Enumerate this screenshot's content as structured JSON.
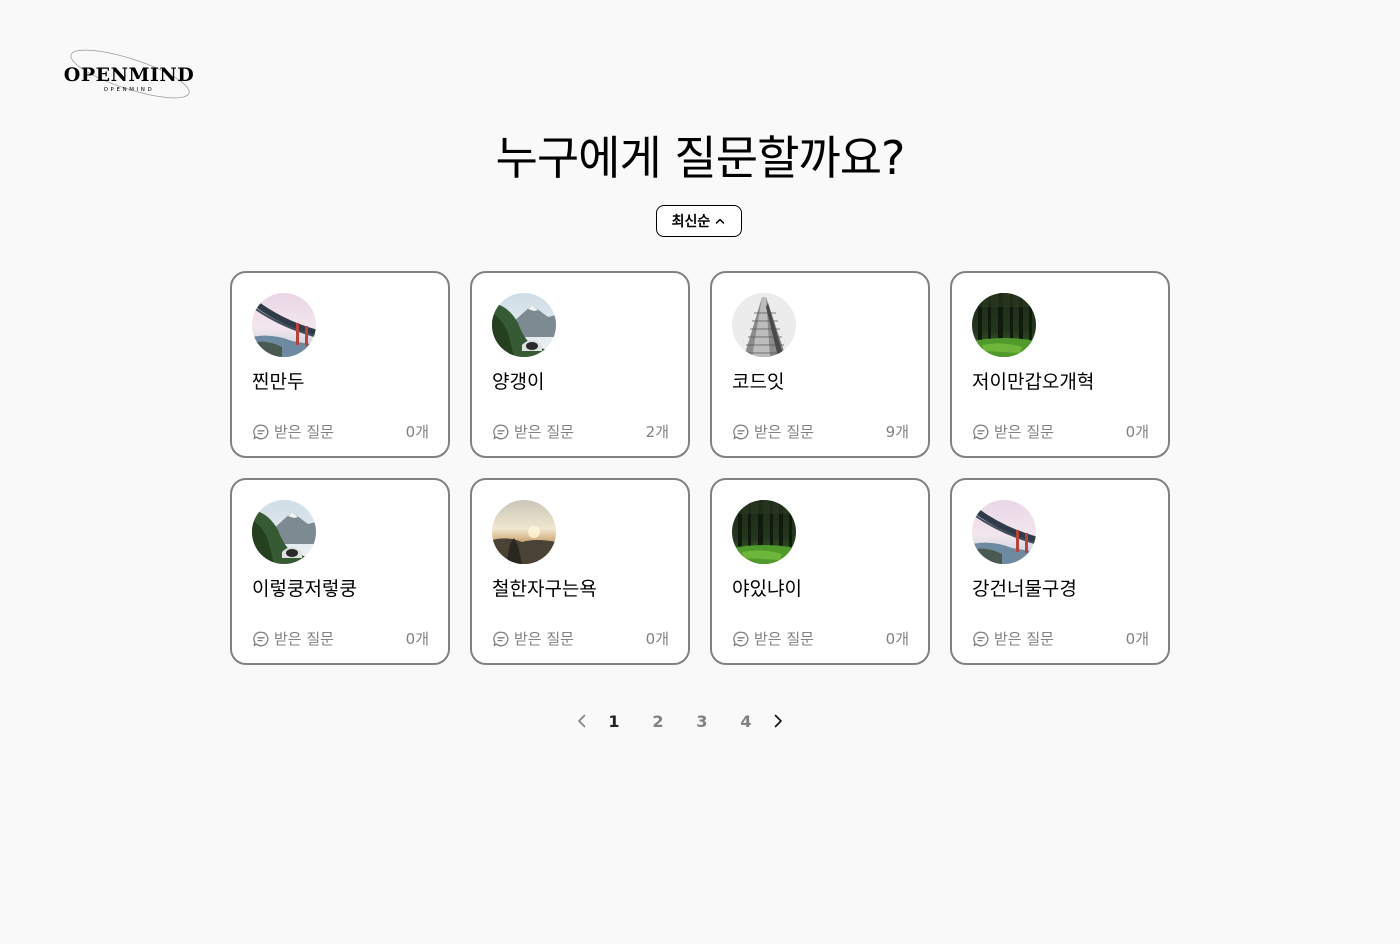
{
  "logo": {
    "text": "OPENMIND",
    "subtext": "OPENMIND"
  },
  "title": "누구에게 질문할까요?",
  "sort": {
    "label": "최신순",
    "icon": "chevron-up-icon"
  },
  "cards": [
    {
      "name": "찐만두",
      "stat_label": "받은 질문",
      "count": "0개",
      "avatar": "bridge"
    },
    {
      "name": "양갱이",
      "stat_label": "받은 질문",
      "count": "2개",
      "avatar": "mountain"
    },
    {
      "name": "코드잇",
      "stat_label": "받은 질문",
      "count": "9개",
      "avatar": "building"
    },
    {
      "name": "저이만갑오개혁",
      "stat_label": "받은 질문",
      "count": "0개",
      "avatar": "forest"
    },
    {
      "name": "이렇쿵저렇쿵",
      "stat_label": "받은 질문",
      "count": "0개",
      "avatar": "mountain"
    },
    {
      "name": "철한자구는욕",
      "stat_label": "받은 질문",
      "count": "0개",
      "avatar": "sunset"
    },
    {
      "name": "야있냐이",
      "stat_label": "받은 질문",
      "count": "0개",
      "avatar": "forest"
    },
    {
      "name": "강건너물구경",
      "stat_label": "받은 질문",
      "count": "0개",
      "avatar": "bridge"
    }
  ],
  "pagination": {
    "pages": [
      "1",
      "2",
      "3",
      "4"
    ],
    "current": "1"
  },
  "colors": {
    "background": "#f9f9f9",
    "card_border": "#818181",
    "muted_text": "#818181"
  }
}
